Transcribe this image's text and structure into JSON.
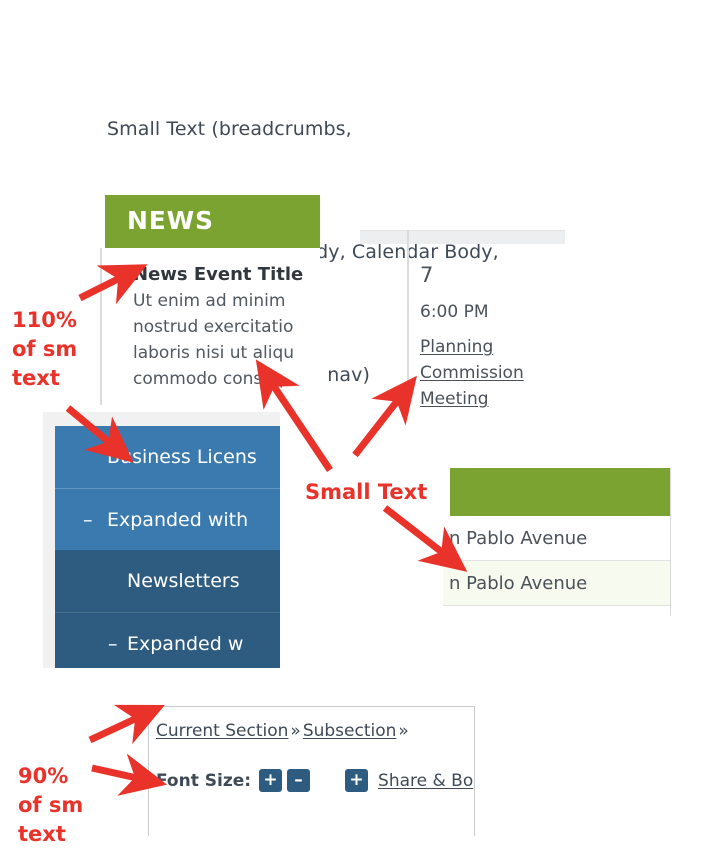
{
  "caption": {
    "line1": "Small Text (breadcrumbs,",
    "line2": "table body, widget body, Calendar Body,",
    "line3": "Important Notice, side nav)"
  },
  "news_widget": {
    "header_title": "NEWS",
    "item_title": "News Event Title",
    "item_body": "Ut enim ad minim\nnostrud exercitatio\nlaboris nisi ut aliqu\ncommodo conseq",
    "header_color": "#7ba332"
  },
  "calendar_widget": {
    "day_number": "7",
    "event_time": "6:00 PM",
    "event_title": "Planning Commission Meeting"
  },
  "side_nav": {
    "items": [
      {
        "label": "Business Licens",
        "toggle": "",
        "level": 1
      },
      {
        "label": "Expanded with",
        "toggle": "–",
        "level": 1
      },
      {
        "label": "Newsletters",
        "toggle": "",
        "level": 2
      },
      {
        "label": "Expanded w",
        "toggle": "–",
        "level": 2
      }
    ],
    "level1_color": "#3b7aae",
    "level2_color": "#2e5c80"
  },
  "data_table": {
    "header_color": "#7ba332",
    "rows": [
      {
        "cell": "n Pablo Avenue"
      },
      {
        "cell": "n Pablo Avenue"
      }
    ]
  },
  "bottom_block": {
    "breadcrumb": {
      "current_section": "Current Section",
      "separator1": "»",
      "subsection": "Subsection",
      "separator2": "»"
    },
    "font_size_label": "Font Size:",
    "increase_label": "+",
    "decrease_label": "–",
    "share_plus_label": "+",
    "share_label": "Share & Bo"
  },
  "annotations": {
    "callout_110": "110%\nof sm\ntext",
    "callout_small_text": "Small Text",
    "callout_90": "90%\nof sm\ntext",
    "arrow_color": "#e8322a"
  }
}
